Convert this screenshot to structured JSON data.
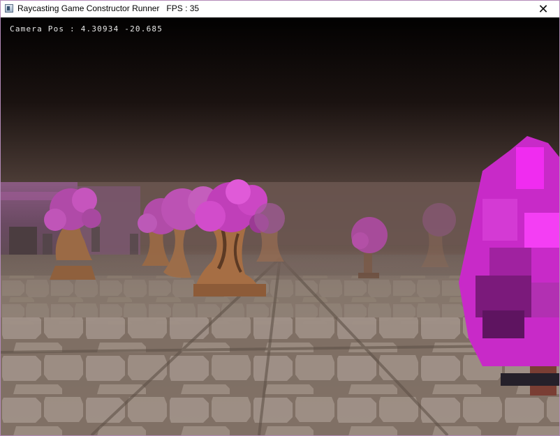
{
  "window": {
    "title": "Raycasting Game Constructor Runner   FPS : 35",
    "close_glyph": "✕",
    "icon": "app-window-icon"
  },
  "hud": {
    "camera_pos": "Camera Pos : 4.30934 -20.685"
  },
  "scene": {
    "colors": {
      "sky_top": "#030101",
      "fog": "#6e5a52",
      "floor": "#8a7a6e",
      "foliage": "#c63ac6",
      "foliage_bright": "#ff20ff",
      "foliage_dark": "#7a1a7a",
      "trunk": "#a86f45",
      "trunk_dark": "#5a3320"
    }
  }
}
